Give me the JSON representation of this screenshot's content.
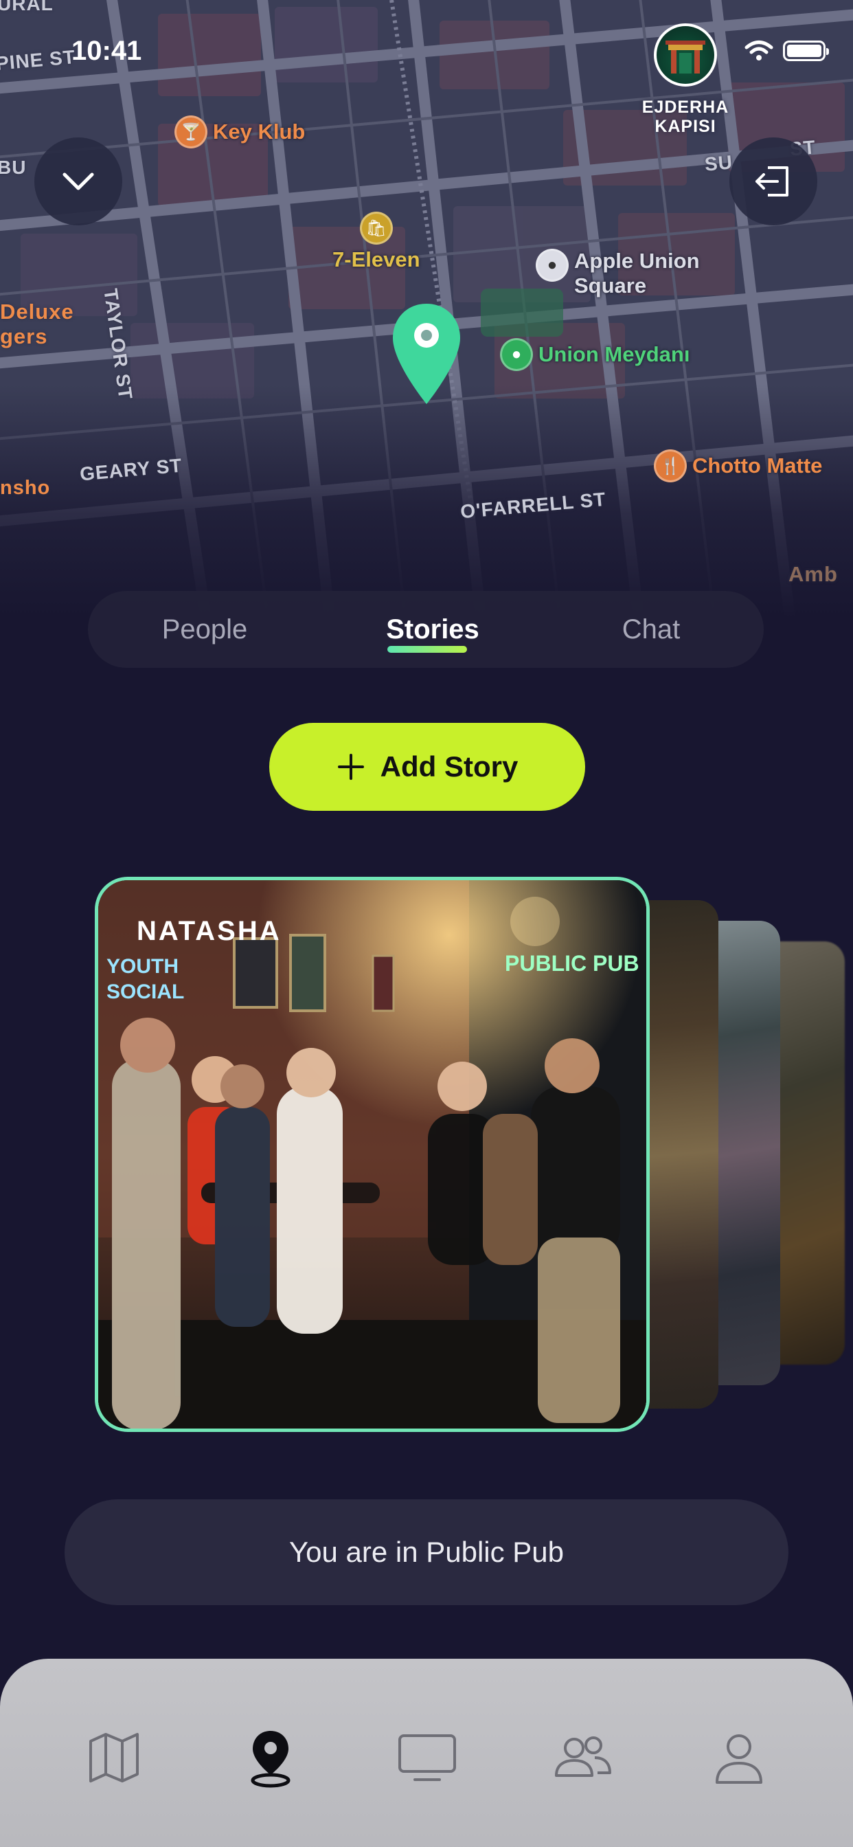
{
  "status_bar": {
    "time": "10:41"
  },
  "venue": {
    "name": "EJDERHA KAPISI"
  },
  "map": {
    "streets": [
      "PINE ST",
      "TAYLOR ST",
      "GEARY ST",
      "O'FARRELL ST",
      "SU",
      "ST"
    ],
    "partial_labels": [
      "URAL",
      "BU",
      "Deluxe",
      "gers",
      "nsho",
      "Amb"
    ],
    "pois": [
      {
        "name": "Key Klub",
        "icon": "bar-icon",
        "color": "#e07a3a"
      },
      {
        "name": "7-Eleven",
        "icon": "shop-icon",
        "color": "#caa12a"
      },
      {
        "name": "Apple Union",
        "name2": "Square",
        "icon": "apple-icon",
        "color": "#dcdde6"
      },
      {
        "name": "Union Meydanı",
        "icon": "park-icon",
        "color": "#2fae5c"
      },
      {
        "name": "Chotto Matte",
        "icon": "restaurant-icon",
        "color": "#e07a3a"
      }
    ]
  },
  "tabs": [
    {
      "label": "People",
      "active": false
    },
    {
      "label": "Stories",
      "active": true
    },
    {
      "label": "Chat",
      "active": false
    }
  ],
  "add_story": {
    "label": "Add Story"
  },
  "story": {
    "user": "NATASHA",
    "signs": {
      "left": "YOUTH",
      "left2": "SOCIAL",
      "right": "PUBLIC PUB"
    }
  },
  "location": {
    "text": "You are in Public Pub"
  },
  "bottom_nav": [
    {
      "name": "map-icon",
      "active": false
    },
    {
      "name": "location-pin-icon",
      "active": true
    },
    {
      "name": "tv-icon",
      "active": false
    },
    {
      "name": "people-icon",
      "active": false
    },
    {
      "name": "profile-icon",
      "active": false
    }
  ],
  "colors": {
    "accent": "#c8f02a",
    "teal": "#5ee6b0",
    "background": "#181630"
  }
}
